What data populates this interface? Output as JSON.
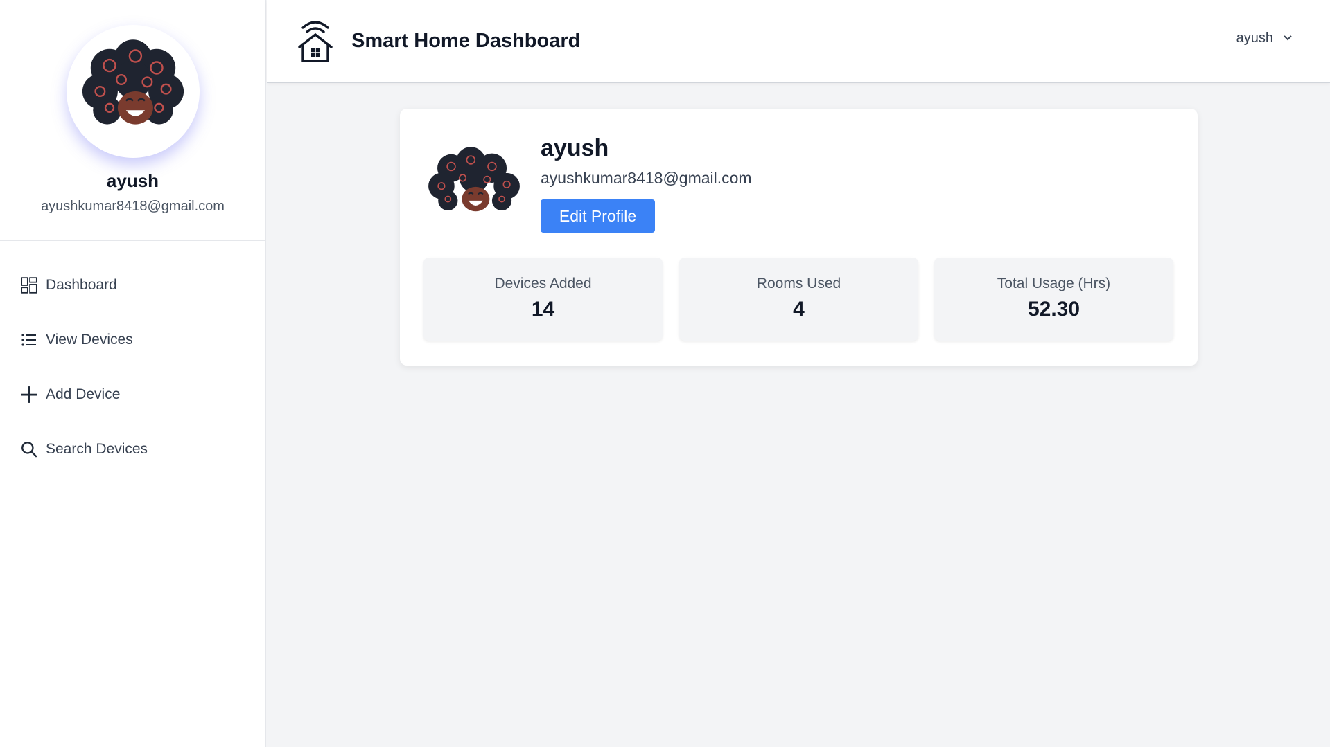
{
  "user": {
    "name": "ayush",
    "email": "ayushkumar8418@gmail.com"
  },
  "sidebar": {
    "items": [
      {
        "label": "Dashboard",
        "icon": "dashboard-grid-icon"
      },
      {
        "label": "View Devices",
        "icon": "list-icon"
      },
      {
        "label": "Add Device",
        "icon": "plus-icon"
      },
      {
        "label": "Search Devices",
        "icon": "search-icon"
      }
    ]
  },
  "header": {
    "title": "Smart Home Dashboard",
    "logo_icon": "smart-home-wifi-icon",
    "user_label": "ayush",
    "dropdown_icon": "chevron-down-icon"
  },
  "profile_card": {
    "name": "ayush",
    "email": "ayushkumar8418@gmail.com",
    "edit_button": "Edit Profile"
  },
  "stats": [
    {
      "label": "Devices Added",
      "value": "14"
    },
    {
      "label": "Rooms Used",
      "value": "4"
    },
    {
      "label": "Total Usage (Hrs)",
      "value": "52.30"
    }
  ],
  "colors": {
    "accent": "#3b82f6",
    "background": "#f3f4f6",
    "surface": "#ffffff"
  }
}
